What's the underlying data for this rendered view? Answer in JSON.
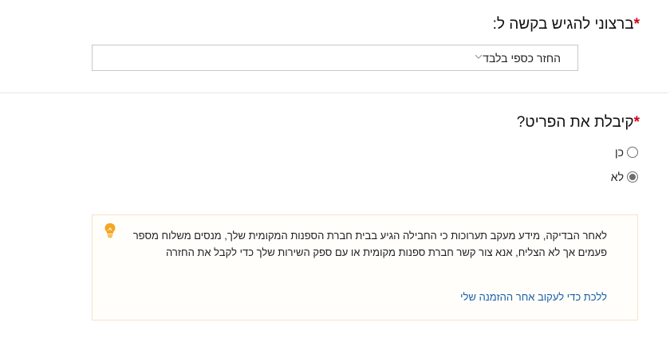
{
  "request_section": {
    "required_mark": "*",
    "question": "ברצוני להגיש בקשה ל:",
    "dropdown": {
      "selected_value": "החזר כספי בלבד",
      "icon": "chevron-down-icon"
    }
  },
  "received_section": {
    "required_mark": "*",
    "question": "קיבלת את הפריט?",
    "options": [
      {
        "label": "כן",
        "checked": false
      },
      {
        "label": "לא",
        "checked": true
      }
    ]
  },
  "info_box": {
    "icon": "lightbulb-icon",
    "message": "לאחר הבדיקה, מידע מעקב תערוכות כי החבילה הגיע בבית חברת הספנות המקומית שלך, מנסים משלוח מספר פעמים אך לא הצליח, אנא צור קשר חברת ספנות מקומית או עם ספק השירות שלך כדי לקבל את החזרה",
    "link_text": "ללכת כדי לעקוב אחר ההזמנה שלי"
  },
  "colors": {
    "required": "#d4001a",
    "link": "#1a5fa8",
    "info_border": "#f6e2c8",
    "bulb": "#f5a623"
  }
}
